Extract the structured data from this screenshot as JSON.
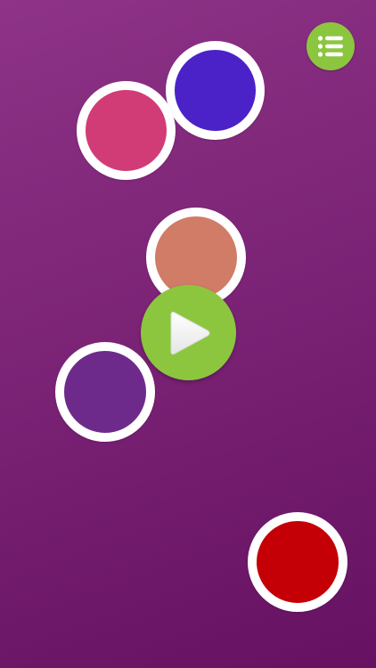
{
  "background": {
    "gradient_start": "#8e3387",
    "gradient_end": "#661162"
  },
  "menu_button": {
    "icon": "list-icon",
    "color": "#8cc63f"
  },
  "play_button": {
    "icon": "play-icon",
    "color": "#8cc63f"
  },
  "dots": [
    {
      "name": "dot-blue",
      "color": "#4b22c8"
    },
    {
      "name": "dot-pink",
      "color": "#d23c76"
    },
    {
      "name": "dot-salmon",
      "color": "#d07c67"
    },
    {
      "name": "dot-purple",
      "color": "#6e2a8b"
    },
    {
      "name": "dot-red",
      "color": "#c40006"
    }
  ]
}
